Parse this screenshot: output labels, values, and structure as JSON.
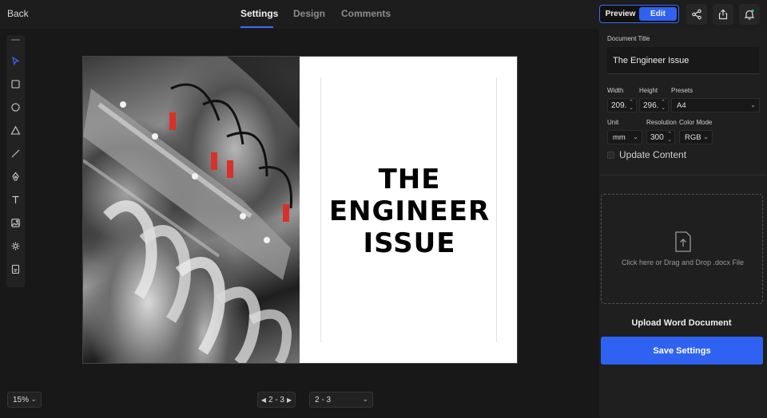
{
  "topbar": {
    "back_label": "Back",
    "tabs": [
      {
        "label": "Settings",
        "active": true
      },
      {
        "label": "Design",
        "active": false
      },
      {
        "label": "Comments",
        "active": false
      }
    ],
    "mode": {
      "preview_label": "Preview",
      "edit_label": "Edit",
      "selected": "Edit"
    },
    "icons": [
      "share-icon",
      "export-icon",
      "notification-bell-icon"
    ]
  },
  "toolbar": {
    "tools": [
      "select-pointer-icon",
      "rectangle-icon",
      "circle-icon",
      "triangle-icon",
      "line-icon",
      "pen-icon",
      "text-icon",
      "image-icon",
      "component-icon",
      "page-icon"
    ]
  },
  "canvas": {
    "page_title": "THE\nENGINEER\nISSUE",
    "photo": "engine-photo"
  },
  "bottom": {
    "zoom": "15%",
    "page_range": "2 - 3",
    "page_select": "2 - 3"
  },
  "panel": {
    "document_title_label": "Document Title",
    "document_title_value": "The Engineer Issue",
    "width_label": "Width",
    "width_value": "209.",
    "height_label": "Height",
    "height_value": "296.",
    "presets_label": "Presets",
    "presets_value": "A4",
    "unit_label": "Unit",
    "unit_value": "mm",
    "resolution_label": "Resolution",
    "resolution_value": "300",
    "color_mode_label": "Color Mode",
    "color_mode_value": "RGB",
    "update_content_label": "Update Content",
    "update_content_checked": false,
    "dropzone_text": "Click here or Drag and Drop .docx File",
    "upload_title": "Upload Word Document",
    "save_label": "Save Settings"
  },
  "colors": {
    "accent": "#2f62f0",
    "background": "#181818",
    "panel": "#1f1f1f"
  }
}
